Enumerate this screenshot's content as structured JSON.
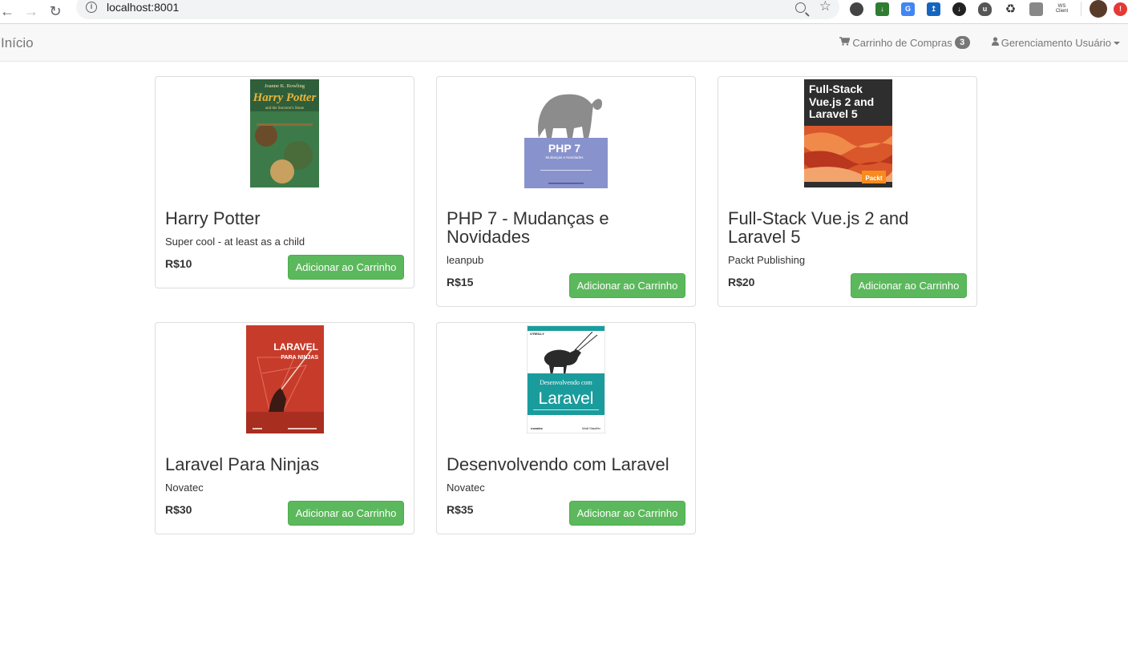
{
  "browser": {
    "url": "localhost:8001",
    "extensions": [
      "glasses-icon",
      "download-icon",
      "translate-icon",
      "export-icon",
      "clip-icon",
      "ublock-icon",
      "recycle-icon",
      "puzzle-icon",
      "ws-client-icon",
      "avatar",
      "alert-icon"
    ],
    "ws_client_label": "WS\nClient"
  },
  "navbar": {
    "brand": "Início",
    "cart_label": "Carrinho de Compras",
    "cart_count": "3",
    "user_menu_label": "Gerenciamento Usuário"
  },
  "products": [
    {
      "title": "Harry Potter",
      "publisher": "Super cool - at least as a child",
      "price": "R$10",
      "button": "Adicionar ao Carrinho",
      "cover": {
        "author": "Joanne K. Rowling",
        "title": "Harry Potter",
        "subtitle": "and the Sorcerer's Stone",
        "color": "#2f5f3a"
      }
    },
    {
      "title": "PHP 7 - Mudanças e Novidades",
      "publisher": "leanpub",
      "price": "R$15",
      "button": "Adicionar ao Carrinho",
      "cover": {
        "title": "PHP 7",
        "subtitle": "Mudanças e Novidades",
        "color": "#8892cc"
      }
    },
    {
      "title": "Full-Stack Vue.js 2 and Laravel 5",
      "publisher": "Packt Publishing",
      "price": "R$20",
      "button": "Adicionar ao Carrinho",
      "cover": {
        "title": "Full-Stack Vue.js 2 and Laravel 5",
        "brand": "Packt",
        "color": "#2e2e2e"
      }
    },
    {
      "title": "Laravel Para Ninjas",
      "publisher": "Novatec",
      "price": "R$30",
      "button": "Adicionar ao Carrinho",
      "cover": {
        "title": "LARAVEL",
        "subtitle": "PARA NINJAS",
        "color": "#c73b2b"
      }
    },
    {
      "title": "Desenvolvendo com Laravel",
      "publisher": "Novatec",
      "price": "R$35",
      "button": "Adicionar ao Carrinho",
      "cover": {
        "header": "O'REILLY",
        "title": "Laravel",
        "subtitle": "Desenvolvendo com",
        "publisher": "novatec",
        "author": "Matt Stauffer",
        "color": "#1b9c9c"
      }
    }
  ]
}
